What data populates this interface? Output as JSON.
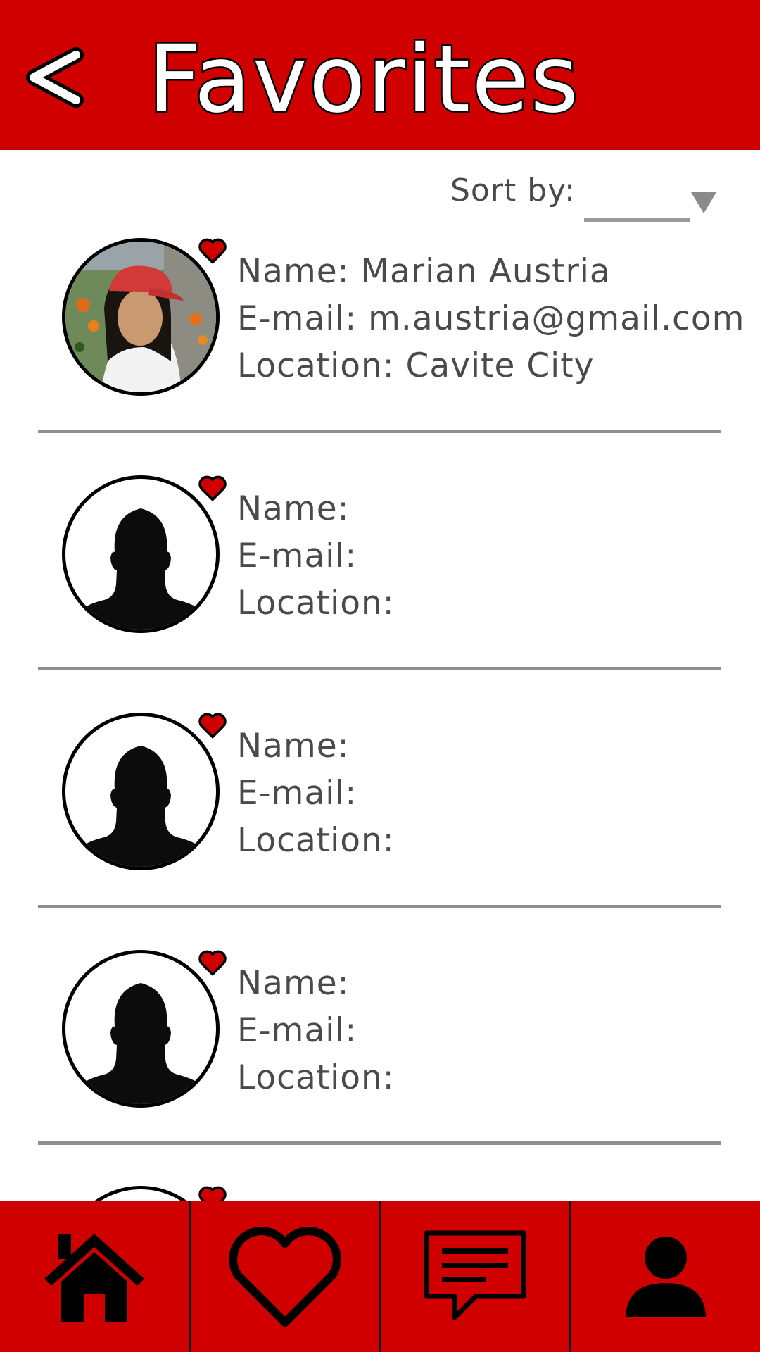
{
  "header": {
    "back_icon": "chevron-left-icon",
    "title": "Favorites"
  },
  "sort": {
    "label": "Sort by:",
    "selected_value": ""
  },
  "favorites": [
    {
      "name": "Name: Marian Austria",
      "email": "E-mail: m.austria@gmail.com",
      "location": "Location: Cavite City",
      "avatar": "photo"
    },
    {
      "name": "Name:",
      "email": "E-mail:",
      "location": "Location:",
      "avatar": "silhouette"
    },
    {
      "name": "Name:",
      "email": "E-mail:",
      "location": "Location:",
      "avatar": "silhouette"
    },
    {
      "name": "Name:",
      "email": "E-mail:",
      "location": "Location:",
      "avatar": "silhouette"
    },
    {
      "name": "",
      "email": "",
      "location": "",
      "avatar": "silhouette"
    }
  ],
  "tabbar": {
    "tabs": [
      {
        "icon": "home-icon"
      },
      {
        "icon": "heart-icon"
      },
      {
        "icon": "chat-icon"
      },
      {
        "icon": "profile-icon"
      }
    ]
  },
  "colors": {
    "brand_red": "#d10000",
    "text_gray": "#4a4a4a",
    "divider_gray": "#8f8f8f"
  }
}
